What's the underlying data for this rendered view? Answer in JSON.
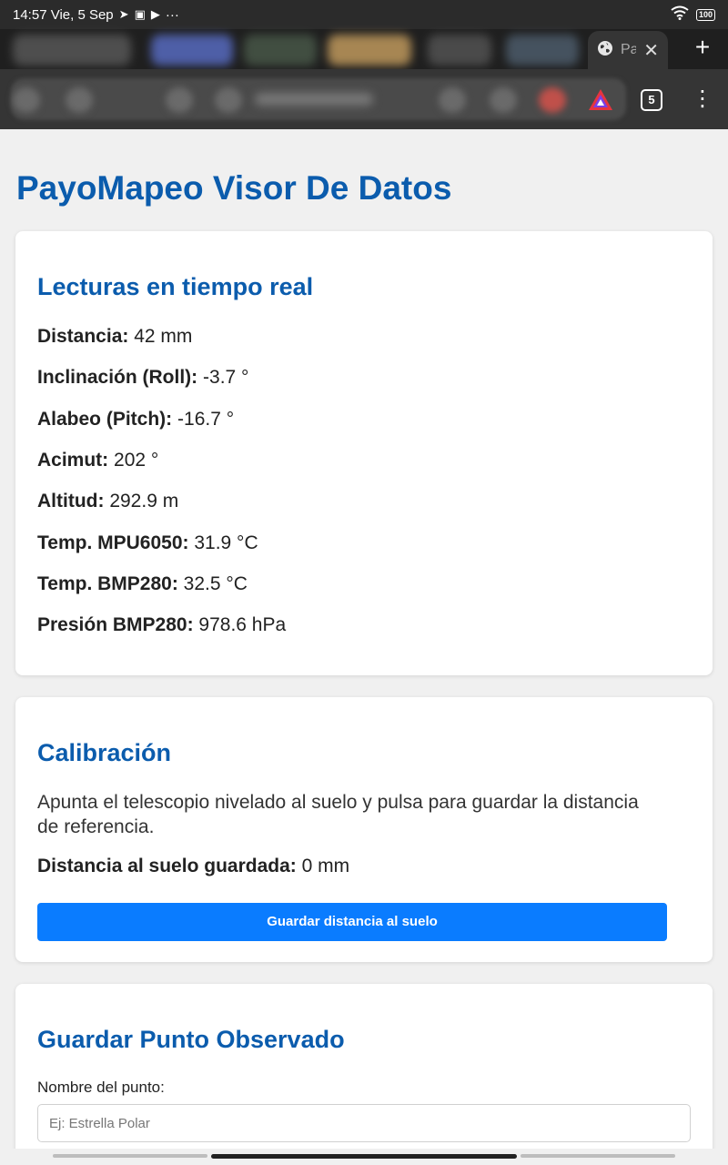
{
  "status_bar": {
    "time_date": "14:57 Vie, 5 Sep",
    "more": "···",
    "battery": "100"
  },
  "browser": {
    "active_tab_title": "Pa",
    "tab_count": "5",
    "new_tab": "+",
    "close_tab": "✕",
    "menu": "⋮"
  },
  "page": {
    "title": "PayoMapeo Visor De Datos",
    "live": {
      "heading": "Lecturas en tiempo real",
      "readings": [
        {
          "label": "Distancia:",
          "value": "42 mm"
        },
        {
          "label": "Inclinación (Roll):",
          "value": "-3.7 °"
        },
        {
          "label": "Alabeo (Pitch):",
          "value": "-16.7 °"
        },
        {
          "label": "Acimut:",
          "value": "202 °"
        },
        {
          "label": "Altitud:",
          "value": "292.9 m"
        },
        {
          "label": "Temp. MPU6050:",
          "value": "31.9 °C"
        },
        {
          "label": "Temp. BMP280:",
          "value": "32.5 °C"
        },
        {
          "label": "Presión BMP280:",
          "value": "978.6 hPa"
        }
      ]
    },
    "calibration": {
      "heading": "Calibración",
      "description": "Apunta el telescopio nivelado al suelo y pulsa para guardar la distancia de referencia.",
      "saved_label": "Distancia al suelo guardada:",
      "saved_value": "0 mm",
      "button": "Guardar distancia al suelo"
    },
    "save_point": {
      "heading": "Guardar Punto Observado",
      "name_label": "Nombre del punto:",
      "name_placeholder": "Ej: Estrella Polar",
      "name_value": ""
    }
  },
  "colors": {
    "heading": "#0b5cad",
    "button": "#0a7cff",
    "background": "#f0f0f0"
  }
}
